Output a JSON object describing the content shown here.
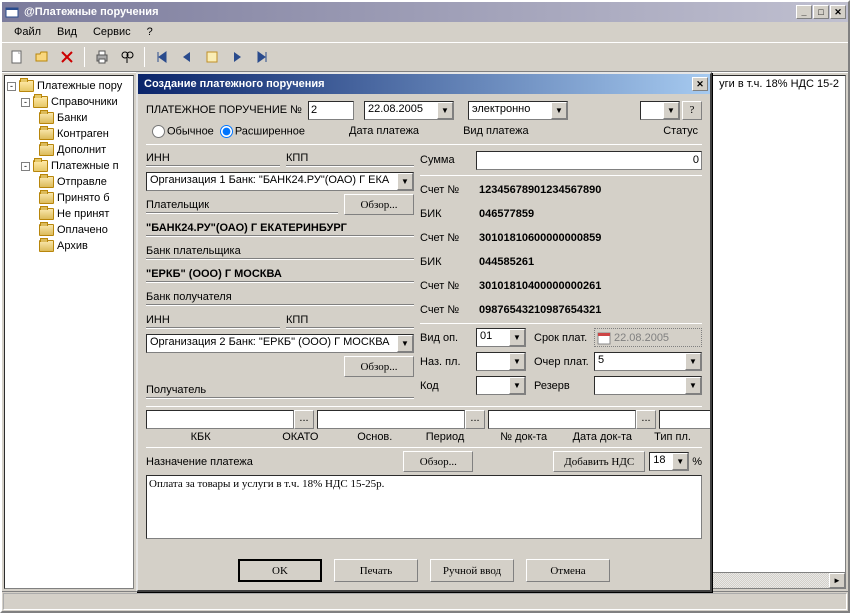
{
  "window": {
    "title": "@Платежные поручения"
  },
  "menu": [
    "Файл",
    "Вид",
    "Сервис",
    "?"
  ],
  "tree": {
    "root": "Платежные пору",
    "n1": "Справочники",
    "n1a": "Банки",
    "n1b": "Контраген",
    "n1c": "Дополнит",
    "n2": "Платежные п",
    "n2a": "Отправле",
    "n2b": "Принято б",
    "n2c": "Не принят",
    "n2d": "Оплачено",
    "n2e": "Архив"
  },
  "list": {
    "row1": "уги в т.ч. 18% НДС 15-2"
  },
  "dialog": {
    "title": "Создание платежного поручения",
    "header_label": "ПЛАТЕЖНОЕ ПОРУЧЕНИЕ №",
    "number": "2",
    "date": "22.08.2005",
    "date_lbl": "Дата платежа",
    "payment_kind": "электронно",
    "payment_kind_lbl": "Вид платежа",
    "status_lbl": "Статус",
    "q": "?",
    "mode_normal": "Обычное",
    "mode_extended": "Расширенное",
    "inn_lbl": "ИНН",
    "kpp_lbl": "КПП",
    "org1": "Организация 1    Банк: \"БАНК24.РУ\"(ОАО) Г ЕКА",
    "browse": "Обзор...",
    "payer_lbl": "Плательщик",
    "payer_bank_name": "\"БАНК24.РУ\"(ОАО) Г ЕКАТЕРИНБУРГ",
    "payer_bank_lbl": "Банк плательщика",
    "recv_bank_name": "\"ЕРКБ\" (ООО) Г МОСКВА",
    "recv_bank_lbl": "Банк получателя",
    "org2": "Организация 2    Банк: \"ЕРКБ\" (ООО) Г МОСКВА",
    "recipient_lbl": "Получатель",
    "sum_lbl": "Сумма",
    "sum": "0",
    "acct_lbl": "Счет №",
    "bik_lbl": "БИК",
    "acct1": "12345678901234567890",
    "bik1": "046577859",
    "acct_b1": "30101810600000000859",
    "bik2": "044585261",
    "acct_b2": "30101810400000000261",
    "acct2": "09876543210987654321",
    "vid_op_lbl": "Вид оп.",
    "vid_op": "01",
    "srok_lbl": "Срок плат.",
    "srok": "22.08.2005",
    "naz_pl_lbl": "Наз. пл.",
    "ocher_lbl": "Очер плат.",
    "ocher": "5",
    "kod_lbl": "Код",
    "rezerv_lbl": "Резерв",
    "kbk": "КБК",
    "okato": "ОКАТО",
    "osnov": "Основ.",
    "period": "Период",
    "ndok": "№ док-та",
    "datedok": "Дата док-та",
    "tippl": "Тип пл.",
    "purpose_lbl": "Назначение платежа",
    "add_vat": "Добавить НДС",
    "vat_pct": "18",
    "pct": "%",
    "purpose_text": "Оплата за товары и услуги в т.ч. 18% НДС 15-25р.",
    "ok": "OK",
    "print": "Печать",
    "manual": "Ручной ввод",
    "cancel": "Отмена"
  }
}
